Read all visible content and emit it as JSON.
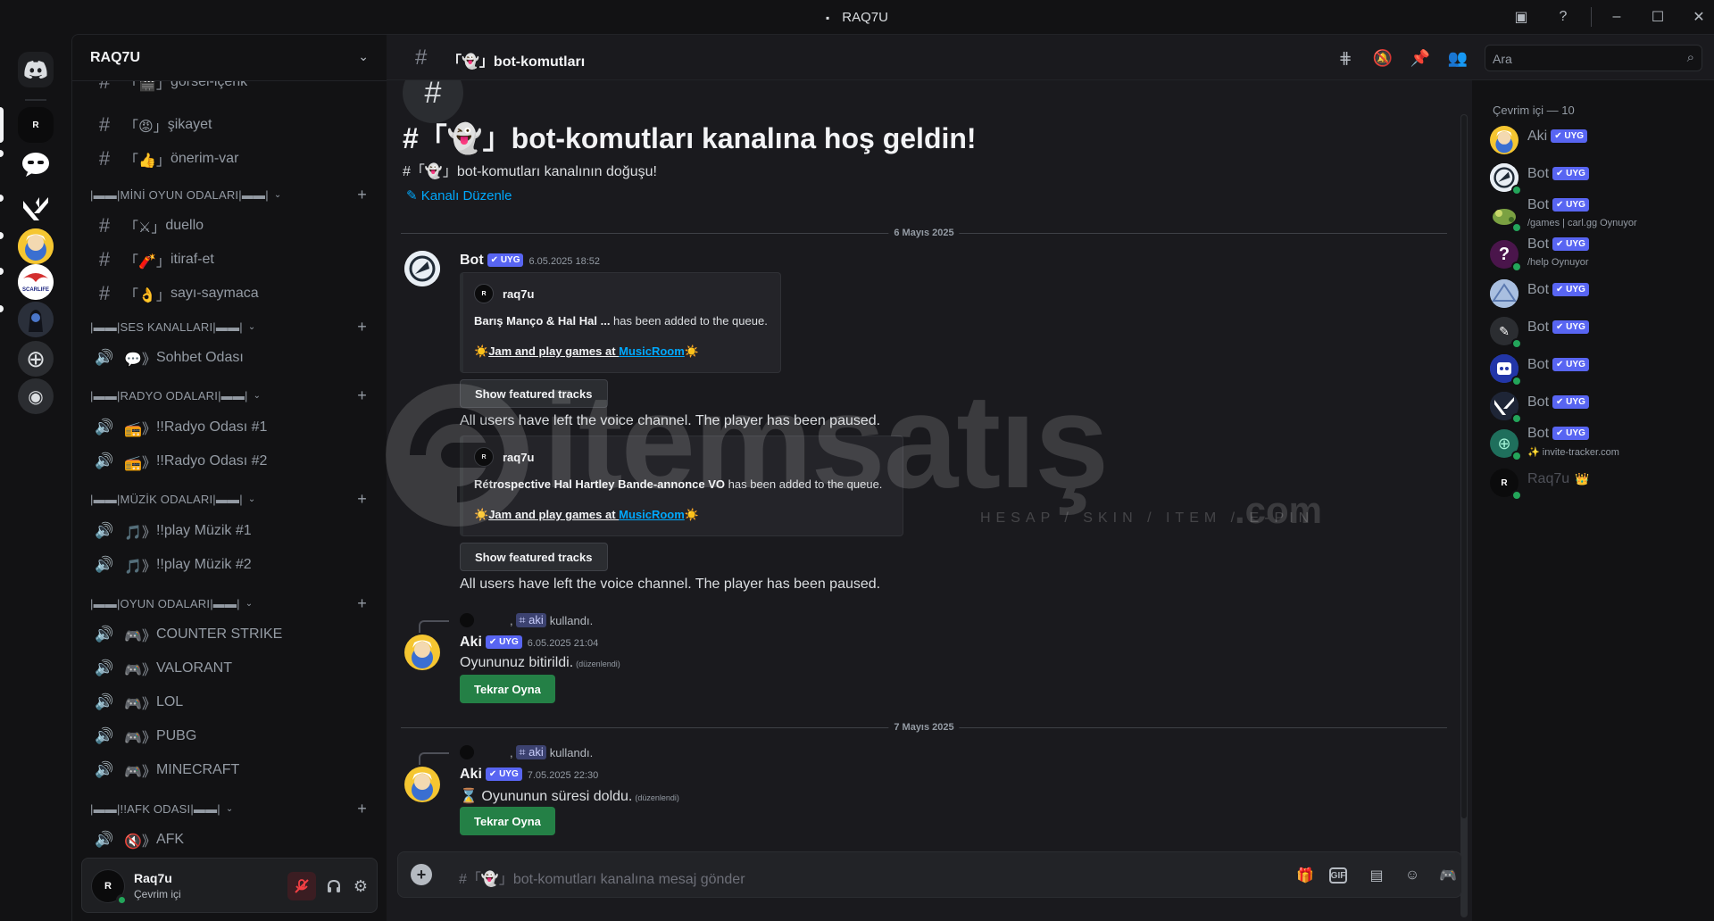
{
  "window": {
    "title": "RAQ7U"
  },
  "guild": {
    "name": "RAQ7U"
  },
  "channels": [
    {
      "prefix": "「🎬」",
      "name": "görsel-içerik",
      "kind": "text"
    },
    {
      "prefix": "「😡」",
      "name": "şikayet",
      "kind": "text"
    },
    {
      "prefix": "「👍」",
      "name": "önerim-var",
      "kind": "text"
    },
    {
      "cat": "|▬▬|MİNİ OYUN ODALARI|▬▬|"
    },
    {
      "prefix": "「⚔」",
      "name": "duello",
      "kind": "text"
    },
    {
      "prefix": "「🧨」",
      "name": "itiraf-et",
      "kind": "text"
    },
    {
      "prefix": "「👌」",
      "name": "sayı-saymaca",
      "kind": "text"
    },
    {
      "cat": "|▬▬|SES KANALLARI|▬▬|"
    },
    {
      "prefix": "💬》",
      "name": "Sohbet Odası",
      "kind": "voice"
    },
    {
      "cat": "|▬▬|RADYO ODALARI|▬▬|"
    },
    {
      "prefix": "📻》",
      "name": "!!Radyo Odası #1",
      "kind": "voice"
    },
    {
      "prefix": "📻》",
      "name": "!!Radyo Odası #2",
      "kind": "voice"
    },
    {
      "cat": "|▬▬|MÜZİK ODALARI|▬▬|"
    },
    {
      "prefix": "🎵》",
      "name": "!!play Müzik #1",
      "kind": "voice"
    },
    {
      "prefix": "🎵》",
      "name": "!!play Müzik #2",
      "kind": "voice"
    },
    {
      "cat": "|▬▬|OYUN ODALARI|▬▬|"
    },
    {
      "prefix": "🎮》",
      "name": "COUNTER STRIKE",
      "kind": "voice"
    },
    {
      "prefix": "🎮》",
      "name": "VALORANT",
      "kind": "voice"
    },
    {
      "prefix": "🎮》",
      "name": "LOL",
      "kind": "voice"
    },
    {
      "prefix": "🎮》",
      "name": "PUBG",
      "kind": "voice"
    },
    {
      "prefix": "🎮》",
      "name": "MINECRAFT",
      "kind": "voice"
    },
    {
      "cat": "|▬▬|!!AFK ODASI|▬▬|"
    },
    {
      "prefix": "🔇》",
      "name": "AFK",
      "kind": "voice"
    }
  ],
  "user": {
    "name": "Raq7u",
    "status": "Çevrim içi",
    "avatar_text": "R"
  },
  "header": {
    "channel": "「👻」bot-komutları",
    "search_placeholder": "Ara"
  },
  "welcome": {
    "title": "#「👻」bot-komutları kanalına hoş geldin!",
    "subtitle": "#「👻」bot-komutları kanalının doğuşu!",
    "edit": "Kanalı Düzenle"
  },
  "dates": {
    "d1": "6 Mayıs 2025",
    "d2": "7 Mayıs 2025"
  },
  "messages": {
    "bot": {
      "author": "Bot",
      "badge": "✔ UYG",
      "time": "6.05.2025 18:52",
      "embed1": {
        "author": "raq7u",
        "track": "Barış Manço & Hal Hal ...",
        "suffix": " has been added to the queue.",
        "promo_prefix": "☀️",
        "promo": "Jam and play games at ",
        "promo_link": "MusicRoom",
        "promo_suffix": "☀️"
      },
      "featured": "Show featured tracks",
      "left1": "All users have left the voice channel. The player has been paused.",
      "embed2": {
        "author": "raq7u",
        "track": "Rétrospective Hal Hartley Bande-annonce VO",
        "suffix": " has been added to the queue.",
        "promo_prefix": "☀️",
        "promo": "Jam and play games at ",
        "promo_link": "MusicRoom",
        "promo_suffix": "☀️"
      },
      "featured2": "Show featured tracks",
      "left2": "All users have left the voice channel. The player has been paused."
    },
    "aki1": {
      "reply_cmd": "⌗ aki",
      "reply_used": "kullandı.",
      "author": "Aki",
      "badge": "✔ UYG",
      "time": "6.05.2025 21:04",
      "text": "Oyununuz bitirildi.",
      "edited": "(düzenlendi)",
      "button": "Tekrar Oyna"
    },
    "aki2": {
      "reply_cmd": "⌗ aki",
      "reply_used": "kullandı.",
      "author": "Aki",
      "badge": "✔ UYG",
      "time": "7.05.2025 22:30",
      "text": "⌛ Oyununun süresi doldu.",
      "edited": "(düzenlendi)",
      "button": "Tekrar Oyna"
    }
  },
  "composer": {
    "placeholder": "#「👻」bot-komutları kanalına mesaj gönder"
  },
  "members": {
    "header": "Çevrim içi — 10",
    "list": [
      {
        "name": "Aki",
        "badge": "✔ UYG",
        "activity": "",
        "color": "#f0b232"
      },
      {
        "name": "Bot",
        "badge": "✔ UYG",
        "activity": "",
        "color": "#d7e3ee"
      },
      {
        "name": "Bot",
        "badge": "✔ UYG",
        "activity": "/games | carl.gg Oynuyor",
        "color": "#6e8b3d"
      },
      {
        "name": "Bot",
        "badge": "✔ UYG",
        "activity": "/help Oynuyor",
        "color": "#4a154b"
      },
      {
        "name": "Bot",
        "badge": "✔ UYG",
        "activity": "",
        "color": "#9fb6d9"
      },
      {
        "name": "Bot",
        "badge": "✔ UYG",
        "activity": "",
        "color": "#2b2d31"
      },
      {
        "name": "Bot",
        "badge": "✔ UYG",
        "activity": "",
        "color": "#3a50c8"
      },
      {
        "name": "Bot",
        "badge": "✔ UYG",
        "activity": "",
        "color": "#2f3a5a"
      },
      {
        "name": "Bot",
        "badge": "✔ UYG",
        "activity": "✨ invite-tracker.com",
        "color": "#1f6f5c"
      },
      {
        "name": "Raq7u",
        "badge": "👑",
        "activity": "",
        "color": "#0b0b0c"
      }
    ]
  },
  "watermark": {
    "brand": "itemsatış",
    "tagline": "HESAP / SKIN / ITEM / E-PIN",
    "tld": ".com"
  },
  "colors": {
    "accent": "#5865f2",
    "green": "#248046",
    "link": "#00a8fc",
    "online": "#23a55a"
  }
}
